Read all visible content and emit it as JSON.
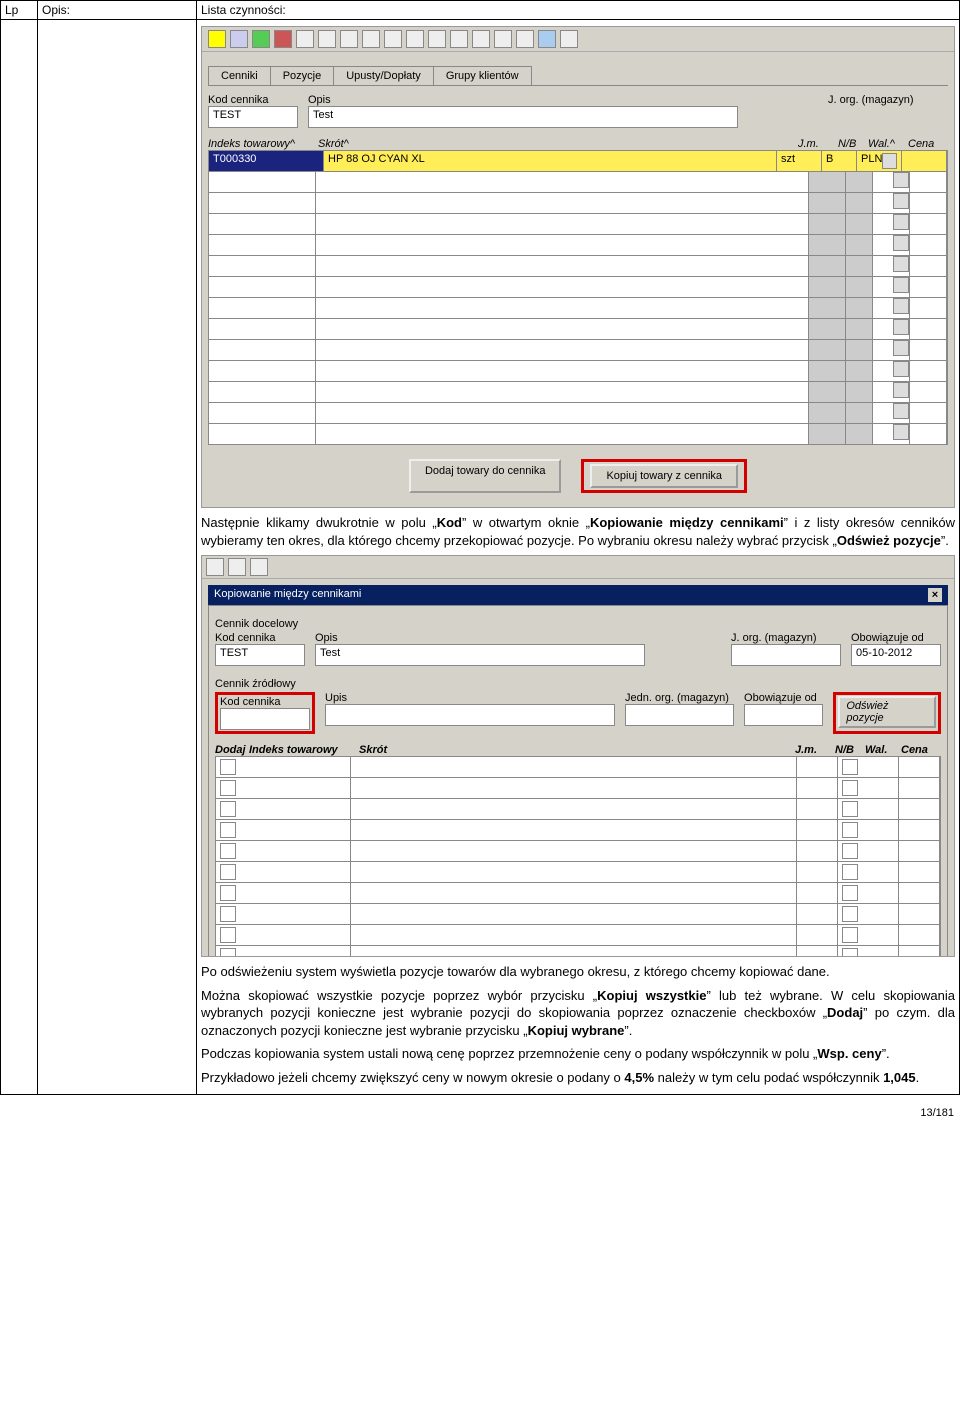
{
  "doc_header": {
    "lp": "Lp",
    "opis": "Opis:",
    "lista": "Lista czynności:"
  },
  "screenshot1": {
    "tabs": [
      "Cenniki",
      "Pozycje",
      "Upusty/Dopłaty",
      "Grupy klientów"
    ],
    "lbl_kod": "Kod cennika",
    "lbl_opis": "Opis",
    "lbl_jorg": "J. org. (magazyn)",
    "val_kod": "TEST",
    "val_opis": "Test",
    "cols": {
      "indeks": "Indeks towarowy^",
      "skrot": "Skrót^",
      "jm": "J.m.",
      "nb": "N/B",
      "wal": "Wal.^",
      "cena": "Cena"
    },
    "row1": {
      "indeks": "T000330",
      "skrot": "HP 88 OJ CYAN XL",
      "jm": "szt",
      "nb": "B",
      "wal": "PLN"
    },
    "btn1": "Dodaj towary do cennika",
    "btn2": "Kopiuj towary z cennika"
  },
  "para1": "Następnie klikamy dwukrotnie w polu „Kod” w otwartym oknie „Kopiowanie między cennikami” i z listy okresów cenników wybieramy ten okres, dla którego chcemy przekopiować pozycje. Po wybraniu okresu należy wybrać przycisk „Odśwież pozycje”.",
  "screenshot2": {
    "title": "Kopiowanie między cennikami",
    "grp1": "Cennik docelowy",
    "lbl_kod": "Kod cennika",
    "lbl_opis": "Opis",
    "lbl_jorg": "J. org. (magazyn)",
    "lbl_obow": "Obowiązuje od",
    "val_kod": "TEST",
    "val_opis": "Test",
    "val_obow": "05-10-2012",
    "grp2": "Cennik źródłowy",
    "lbl_kod2": "Kod cennika",
    "lbl_upis": "Upis",
    "lbl_jedn": "Jedn. org. (magazyn)",
    "lbl_obow2": "Obowiązuje od",
    "btn_odswiez": "Odśwież pozycje",
    "cols": {
      "dodaj": "Dodaj",
      "indeks": "Indeks towarowy",
      "skrot": "Skrót",
      "jm": "J.m.",
      "nb": "N/B",
      "wal": "Wal.",
      "cena": "Cena"
    }
  },
  "para2": "Po odświeżeniu system wyświetla pozycje towarów dla wybranego okresu, z którego chcemy kopiować dane.",
  "para3": "Można skopiować wszystkie pozycje poprzez wybór przycisku „Kopiuj wszystkie” lub też wybrane. W celu skopiowania wybranych pozycji konieczne jest wybranie pozycji do skopiowania poprzez oznaczenie checkboxów „Dodaj” po czym. dla oznaczonych pozycji konieczne jest wybranie przycisku „Kopiuj wybrane”.",
  "para4": "Podczas kopiowania system ustali nową cenę poprzez przemnożenie ceny o podany współczynnik w polu „Wsp. ceny”.",
  "para5": "Przykładowo jeżeli chcemy zwiększyć ceny w nowym okresie o podany o 4,5% należy w tym celu podać współczynnik 1,045.",
  "footer": "13/181"
}
